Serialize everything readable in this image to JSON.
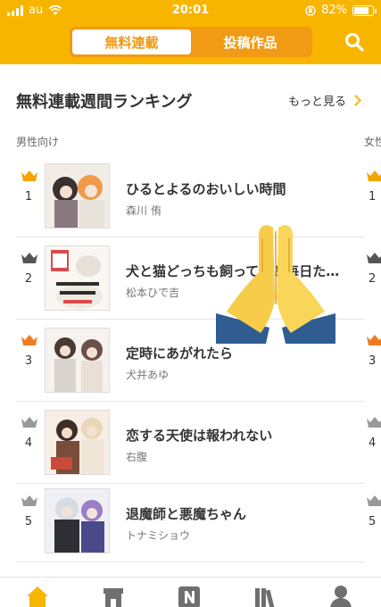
{
  "status_bar": {
    "carrier": "au",
    "time": "20:01",
    "battery": "82%",
    "battery_level": 0.82
  },
  "header": {
    "tabs": [
      {
        "label": "無料連載",
        "active": true
      },
      {
        "label": "投稿作品",
        "active": false
      }
    ],
    "search_icon": "search-icon",
    "accent": "#f7b500"
  },
  "section": {
    "title": "無料連載週間ランキング",
    "more_label": "もっと見る",
    "category": "男性向け",
    "next_category": "女性"
  },
  "ranking": [
    {
      "rank": "1",
      "title": "ひるとよるのおいしい時間",
      "author": "森川 侑",
      "crown_color": "#f4a300"
    },
    {
      "rank": "2",
      "title": "犬と猫どっちも飼ってると毎日たのしい",
      "author": "松本ひで吉",
      "crown_color": "#555555"
    },
    {
      "rank": "3",
      "title": "定時にあがれたら",
      "author": "犬井あゆ",
      "crown_color": "#ee7d22"
    },
    {
      "rank": "4",
      "title": "恋する天使は報われない",
      "author": "右腹",
      "crown_color": "#999999"
    },
    {
      "rank": "5",
      "title": "退魔師と悪魔ちゃん",
      "author": "トナミショウ",
      "crown_color": "#999999"
    }
  ],
  "next_column_ranks": [
    "1",
    "2",
    "3",
    "4",
    "5"
  ],
  "bottom_nav": [
    "home-icon",
    "store-icon",
    "n-icon",
    "library-icon",
    "user-icon"
  ]
}
